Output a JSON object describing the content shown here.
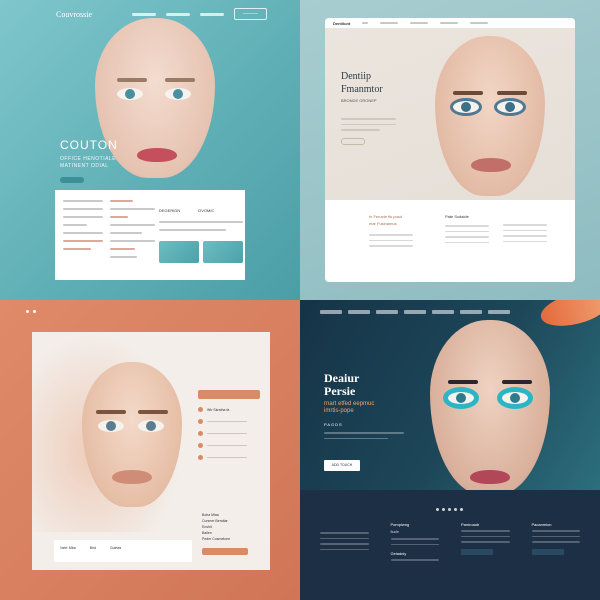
{
  "q1": {
    "logo": "Couvrossie",
    "nav_button": "———",
    "hero_title": "COUTON",
    "hero_sub1": "OFFICE HENOTIALE",
    "hero_sub2": "MATINENT ODIAL",
    "card_col1": "DEGERIDN",
    "card_col2": "OVOMIC",
    "colors": {
      "accent": "#5fb0b6",
      "pink": "#e6a59c"
    }
  },
  "q2": {
    "logo": "Dentilunt",
    "hero_title_line1": "Dentiip",
    "hero_title_line2": "Fmanmtor",
    "hero_sub": "BRONDE ORONEP",
    "bottom_col1_a": "In Feructe fis posd",
    "bottom_col1_b": "mar Fusinamus",
    "bottom_col2": "Pate Scdalde"
  },
  "q3": {
    "panel_head": "",
    "items": [
      "Wtr Skratha fa",
      "Cosmer Durthl",
      "Alnumhle",
      "Sarkhip Olhaks",
      "Nilhaur Odamut"
    ],
    "panel2": [
      "Boha Mlaa",
      "Cunmer Beraltar",
      "Enshit",
      "Ballen",
      "Peder Cosmetone"
    ],
    "foot": [
      "Vaht: Mba",
      "Bird",
      "Guirtas"
    ],
    "colors": {
      "accent": "#d98a66"
    }
  },
  "q4": {
    "hero_title_line1": "Deaiur",
    "hero_title_line2": "Persie",
    "hero_sub_line1": "rnart etfed eepmuc",
    "hero_sub_line2": "imrtis-pope",
    "small_label": "PAGDS",
    "cta": "ADD TOUCH",
    "cols": [
      {
        "h": "",
        "h2": ""
      },
      {
        "h": "Pompiwng",
        "h2": "Itucle"
      },
      {
        "h": "Paniroaub",
        "h2": ""
      },
      {
        "h": "Pacanmion",
        "h2": ""
      }
    ],
    "extra_label": "Geladniy",
    "colors": {
      "accent": "#f0a56f"
    }
  }
}
